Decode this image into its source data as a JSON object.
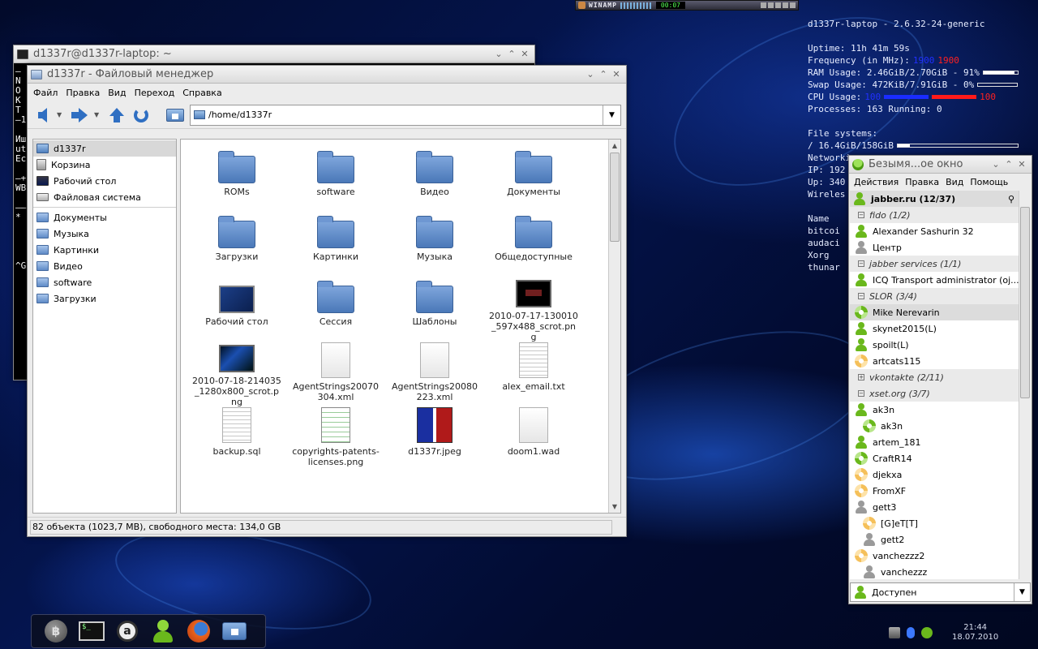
{
  "winamp": {
    "title": "WINAMP",
    "time": "00:07"
  },
  "conky": {
    "host": "d1337r-laptop - 2.6.32-24-generic",
    "uptime": "Uptime: 11h 41m 59s",
    "freq_label": "Frequency (in MHz):",
    "freq_1": "1900",
    "freq_2": "1900",
    "ram": "RAM Usage: 2.46GiB/2.70GiB - 91%",
    "ram_fraction": 0.91,
    "swap": "Swap Usage: 472KiB/7.91GiB - 0%",
    "swap_fraction": 0.0,
    "cpu_label": "CPU Usage:",
    "cpu_1": "100",
    "cpu_2": "100",
    "processes": "Processes: 163  Running: 0",
    "fs_label": "File systems:",
    "fs_root": " / 16.4GiB/158GiB",
    "fs_fraction": 0.1,
    "net_label": "Networking:",
    "ip": "IP: 192",
    "up": "Up: 340",
    "wireless": "Wireles",
    "name_header": "Name",
    "procs": [
      " bitcoi",
      " audaci",
      " Xorg",
      " thunar"
    ]
  },
  "terminal": {
    "title": "d1337r@d1337r-laptop: ~",
    "lines": [
      "—",
      "N",
      "O",
      "K",
      "T",
      "—1",
      "",
      "Иш",
      "ut",
      "Ec",
      "",
      "—+",
      "WB",
      "",
      "——",
      " *",
      "",
      "",
      "",
      "",
      "^G"
    ]
  },
  "filemanager": {
    "title": "d1337r - Файловый менеджер",
    "menu": [
      "Файл",
      "Правка",
      "Вид",
      "Переход",
      "Справка"
    ],
    "path": "/home/d1337r",
    "sidebar": [
      {
        "label": "d1337r",
        "icon": "home"
      },
      {
        "label": "Корзина",
        "icon": "trash"
      },
      {
        "label": "Рабочий стол",
        "icon": "desk"
      },
      {
        "label": "Файловая система",
        "icon": "drive"
      },
      {
        "label": "Документы",
        "icon": "folder"
      },
      {
        "label": "Музыка",
        "icon": "folder"
      },
      {
        "label": "Картинки",
        "icon": "folder"
      },
      {
        "label": "Видео",
        "icon": "folder"
      },
      {
        "label": "software",
        "icon": "folder"
      },
      {
        "label": "Загрузки",
        "icon": "folder"
      }
    ],
    "files": [
      {
        "name": "ROMs",
        "type": "folder"
      },
      {
        "name": "software",
        "type": "folder"
      },
      {
        "name": "Видео",
        "type": "folder"
      },
      {
        "name": "Документы",
        "type": "folder"
      },
      {
        "name": "Загрузки",
        "type": "folder"
      },
      {
        "name": "Картинки",
        "type": "folder"
      },
      {
        "name": "Музыка",
        "type": "folder"
      },
      {
        "name": "Общедоступные",
        "type": "folder"
      },
      {
        "name": "Рабочий стол",
        "type": "desk"
      },
      {
        "name": "Сессия",
        "type": "folder"
      },
      {
        "name": "Шаблоны",
        "type": "folder"
      },
      {
        "name": "2010-07-17-130010_597x488_scrot.png",
        "type": "shot"
      },
      {
        "name": "2010-07-18-214035_1280x800_scrot.png",
        "type": "shot-blue"
      },
      {
        "name": "AgentStrings20070304.xml",
        "type": "doc"
      },
      {
        "name": "AgentStrings20080223.xml",
        "type": "doc"
      },
      {
        "name": "alex_email.txt",
        "type": "text"
      },
      {
        "name": "backup.sql",
        "type": "text"
      },
      {
        "name": "copyrights-patents-licenses.png",
        "type": "grid"
      },
      {
        "name": "d1337r.jpeg",
        "type": "d1337"
      },
      {
        "name": "doom1.wad",
        "type": "doc"
      }
    ],
    "status": "82 объекта (1023,7 MB), свободного места: 134,0 GB"
  },
  "jabber": {
    "title": "Безымя...ое окно",
    "menu": [
      "Действия",
      "Правка",
      "Вид",
      "Помощь"
    ],
    "rows": [
      {
        "kind": "account",
        "label": "jabber.ru (12/37)",
        "icon": "user-green"
      },
      {
        "kind": "group",
        "label": "fido (1/2)",
        "sign": "−"
      },
      {
        "kind": "contact",
        "label": "Alexander Sashurin 32",
        "icon": "user-green"
      },
      {
        "kind": "contact",
        "label": "Центр",
        "icon": "user-grey"
      },
      {
        "kind": "group",
        "label": "jabber services (1/1)",
        "sign": "−"
      },
      {
        "kind": "contact",
        "label": "ICQ Transport administrator (oj...",
        "icon": "user-green"
      },
      {
        "kind": "group",
        "label": "SLOR (3/4)",
        "sign": "−"
      },
      {
        "kind": "contact",
        "label": "Mike Nerevarin",
        "icon": "flower-green",
        "selected": true
      },
      {
        "kind": "contact",
        "label": "skynet2015(L)",
        "icon": "user-green"
      },
      {
        "kind": "contact",
        "label": "spoilt(L)",
        "icon": "user-green"
      },
      {
        "kind": "contact",
        "label": "artcats115",
        "icon": "flower"
      },
      {
        "kind": "group",
        "label": "vkontakte (2/11)",
        "sign": "+"
      },
      {
        "kind": "group",
        "label": "xset.org (3/7)",
        "sign": "−"
      },
      {
        "kind": "contact",
        "label": "ak3n",
        "icon": "user-green"
      },
      {
        "kind": "sub",
        "label": "ak3n",
        "icon": "flower-green"
      },
      {
        "kind": "contact",
        "label": "artem_181",
        "icon": "user-green"
      },
      {
        "kind": "contact",
        "label": "CraftR14",
        "icon": "flower-green"
      },
      {
        "kind": "contact",
        "label": "djekxa",
        "icon": "flower"
      },
      {
        "kind": "contact",
        "label": "FromXF",
        "icon": "flower"
      },
      {
        "kind": "contact",
        "label": "gett3",
        "icon": "user-grey"
      },
      {
        "kind": "sub",
        "label": "[G]eT[T]",
        "icon": "flower"
      },
      {
        "kind": "sub",
        "label": "gett2",
        "icon": "user-grey"
      },
      {
        "kind": "contact",
        "label": "vanchezzz2",
        "icon": "flower"
      },
      {
        "kind": "sub",
        "label": "vanchezzz",
        "icon": "user-grey"
      }
    ],
    "status": "Доступен"
  },
  "tray": {
    "time": "21:44",
    "date": "18.07.2010"
  },
  "colors": {
    "conky_blue": "#2030ff",
    "conky_red": "#ff2020",
    "online_green": "#6ab81c"
  }
}
